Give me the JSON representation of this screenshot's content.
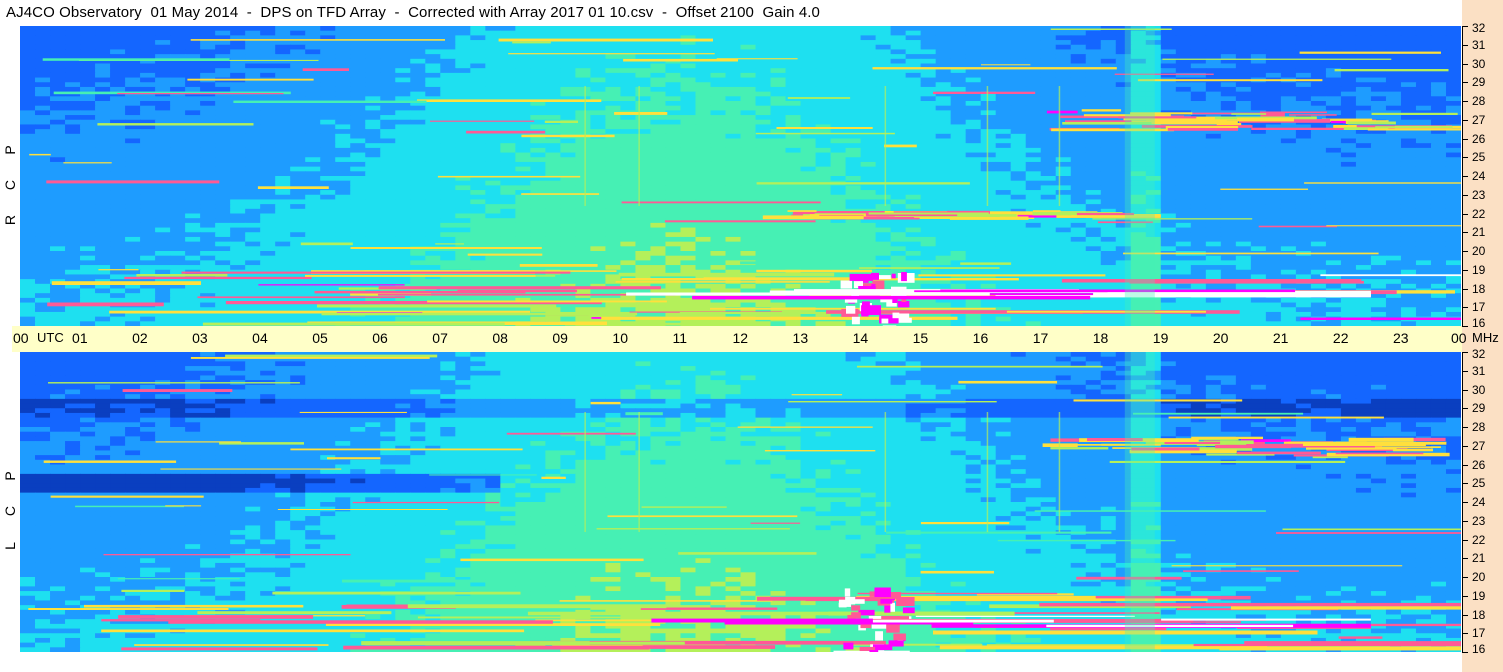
{
  "title": "AJ4CO Observatory  01 May 2014  -  DPS on TFD Array  -  Corrected with Array 2017 01 10.csv  -  Offset 2100  Gain 4.0",
  "chart_data": [
    {
      "type": "heatmap",
      "panel": "RCP",
      "side_label": [
        "P",
        "C",
        "R"
      ],
      "x_axis": {
        "unit": "UTC",
        "range": [
          "00",
          "00"
        ],
        "tick_labels": [
          "00",
          "01",
          "02",
          "03",
          "04",
          "05",
          "06",
          "07",
          "08",
          "09",
          "10",
          "11",
          "12",
          "13",
          "14",
          "15",
          "16",
          "17",
          "18",
          "19",
          "20",
          "21",
          "22",
          "23",
          "00"
        ]
      },
      "y_axis": {
        "unit": "MHz",
        "range": [
          16,
          32
        ],
        "tick_labels": [
          "32",
          "31",
          "30",
          "29",
          "28",
          "27",
          "26",
          "25",
          "24",
          "23",
          "22",
          "21",
          "20",
          "19",
          "18",
          "17",
          "16"
        ]
      },
      "features": [
        {
          "kind": "noise_band",
          "mhz": [
            16,
            19
          ],
          "hours": [
            0,
            24
          ],
          "intensity": "high"
        },
        {
          "kind": "bright_burst",
          "mhz": [
            16,
            19
          ],
          "hours": [
            13.6,
            14.9
          ],
          "intensity": "very_high"
        },
        {
          "kind": "bright_band",
          "mhz": [
            17.6,
            18.0
          ],
          "hours": [
            9.5,
            22.5
          ],
          "intensity": "very_high"
        },
        {
          "kind": "noise_band",
          "mhz": [
            26.5,
            27.5
          ],
          "hours": [
            17,
            24
          ],
          "intensity": "high"
        },
        {
          "kind": "noise_band",
          "mhz": [
            21.8,
            22.2
          ],
          "hours": [
            12,
            19
          ],
          "intensity": "high"
        },
        {
          "kind": "vertical_streak",
          "hours": [
            18.4,
            18.9
          ],
          "intensity": "medium"
        }
      ]
    },
    {
      "type": "heatmap",
      "panel": "LCP",
      "side_label": [
        "P",
        "C",
        "L"
      ],
      "x_axis": {
        "unit": "UTC",
        "range": [
          "00",
          "00"
        ],
        "tick_labels": [
          "00",
          "01",
          "02",
          "03",
          "04",
          "05",
          "06",
          "07",
          "08",
          "09",
          "10",
          "11",
          "12",
          "13",
          "14",
          "15",
          "16",
          "17",
          "18",
          "19",
          "20",
          "21",
          "22",
          "23",
          "00"
        ]
      },
      "y_axis": {
        "unit": "MHz",
        "range": [
          16,
          32
        ],
        "tick_labels": [
          "32",
          "31",
          "30",
          "29",
          "28",
          "27",
          "26",
          "25",
          "24",
          "23",
          "22",
          "21",
          "20",
          "19",
          "18",
          "17",
          "16"
        ]
      },
      "features": [
        {
          "kind": "dark_band",
          "mhz": [
            24.5,
            25.5
          ],
          "hours": [
            0,
            8
          ],
          "intensity": "very_low"
        },
        {
          "kind": "dark_band",
          "mhz": [
            28.5,
            29.5
          ],
          "hours": [
            0,
            24
          ],
          "intensity": "low"
        },
        {
          "kind": "noise_band",
          "mhz": [
            16,
            19
          ],
          "hours": [
            0,
            24
          ],
          "intensity": "high"
        },
        {
          "kind": "bright_burst",
          "mhz": [
            16,
            19.5
          ],
          "hours": [
            13.6,
            14.9
          ],
          "intensity": "very_high"
        },
        {
          "kind": "bright_band",
          "mhz": [
            17.4,
            17.8
          ],
          "hours": [
            9.5,
            22.5
          ],
          "intensity": "very_high"
        },
        {
          "kind": "noise_band",
          "mhz": [
            26.5,
            27.5
          ],
          "hours": [
            17,
            24
          ],
          "intensity": "high"
        },
        {
          "kind": "vertical_streak",
          "hours": [
            18.4,
            18.9
          ],
          "intensity": "medium"
        }
      ]
    }
  ],
  "axis_labels": {
    "utc": "UTC",
    "mhz": "MHz"
  },
  "colors": {
    "axis_band": "#ffffc8",
    "right_strip": "#fbe0c4",
    "colormap": [
      "#061a66",
      "#0a3fc0",
      "#1466ff",
      "#1e9cff",
      "#1ee0f0",
      "#46f0b4",
      "#b4f05a",
      "#ffe03c",
      "#ff5a96",
      "#ff00ff",
      "#ffffff"
    ]
  }
}
